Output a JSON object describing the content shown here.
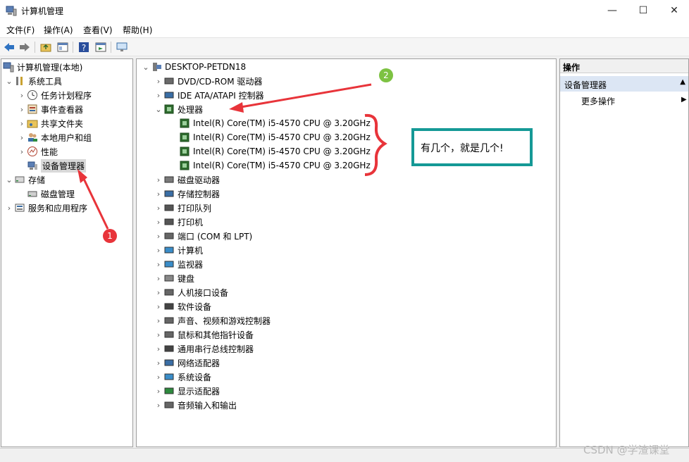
{
  "window": {
    "title": "计算机管理",
    "minimize_glyph": "—",
    "maximize_glyph": "☐",
    "close_glyph": "✕"
  },
  "menu": [
    "文件(F)",
    "操作(A)",
    "查看(V)",
    "帮助(H)"
  ],
  "toolbar": {
    "icons": [
      "back-icon",
      "forward-icon",
      "up-folder-icon",
      "show-hide-tree-icon",
      "help-icon",
      "properties-icon",
      "monitor-icon"
    ]
  },
  "left_tree": {
    "root": "计算机管理(本地)",
    "system_tools": "系统工具",
    "task_scheduler": "任务计划程序",
    "event_viewer": "事件查看器",
    "shared_folders": "共享文件夹",
    "local_users": "本地用户和组",
    "performance": "性能",
    "device_manager": "设备管理器",
    "storage": "存储",
    "disk_management": "磁盘管理",
    "services_apps": "服务和应用程序"
  },
  "device_tree": {
    "root": "DESKTOP-PETDN18",
    "categories": [
      "DVD/CD-ROM 驱动器",
      "IDE ATA/ATAPI 控制器",
      "处理器",
      "磁盘驱动器",
      "存储控制器",
      "打印队列",
      "打印机",
      "端口 (COM 和 LPT)",
      "计算机",
      "监视器",
      "键盘",
      "人机接口设备",
      "软件设备",
      "声音、视频和游戏控制器",
      "鼠标和其他指针设备",
      "通用串行总线控制器",
      "网络适配器",
      "系统设备",
      "显示适配器",
      "音频输入和输出"
    ],
    "processors": [
      "Intel(R) Core(TM) i5-4570 CPU @ 3.20GHz",
      "Intel(R) Core(TM) i5-4570 CPU @ 3.20GHz",
      "Intel(R) Core(TM) i5-4570 CPU @ 3.20GHz",
      "Intel(R) Core(TM) i5-4570 CPU @ 3.20GHz"
    ]
  },
  "actions": {
    "header": "操作",
    "section": "设备管理器",
    "more": "更多操作"
  },
  "annotations": {
    "callout": "有几个，就是几个!",
    "badge1": "1",
    "badge2": "2",
    "arrow_color": "#e8343a",
    "callout_border": "#159996"
  },
  "watermark": "CSDN @学渣课堂"
}
